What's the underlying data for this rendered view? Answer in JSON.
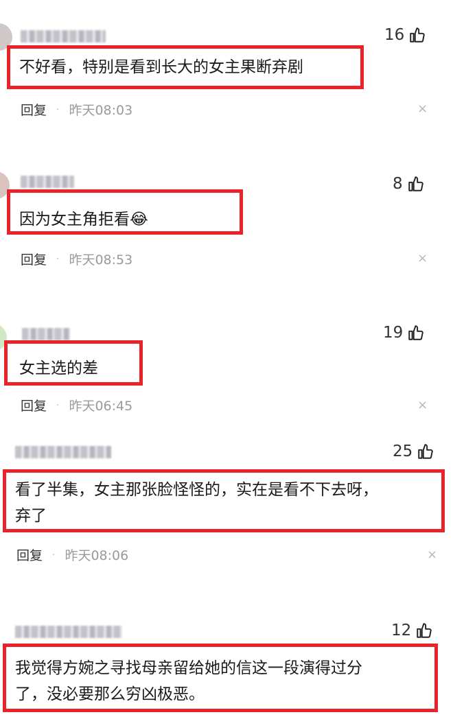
{
  "comments": [
    {
      "likes": "16",
      "text_lines": [
        "不好看，特别是看到长大的女主果断弃剧"
      ],
      "reply_label": "回复",
      "time": "昨天08:03"
    },
    {
      "likes": "8",
      "text_lines": [
        "因为女主角拒看😂"
      ],
      "reply_label": "回复",
      "time": "昨天08:53"
    },
    {
      "likes": "19",
      "text_lines": [
        "女主选的差"
      ],
      "reply_label": "回复",
      "time": "昨天06:45"
    },
    {
      "likes": "25",
      "text_lines": [
        "看了半集，女主那张脸怪怪的，实在是看不下去呀，",
        "弃了"
      ],
      "reply_label": "回复",
      "time": "昨天08:06"
    },
    {
      "likes": "12",
      "text_lines": [
        "我觉得方婉之寻找母亲留给她的信这一段演得过分",
        "了，没必要那么穷凶极恶。"
      ],
      "reply_label": "",
      "time": ""
    }
  ],
  "separator": "·",
  "close_glyph": "×",
  "colors": {
    "highlight_box": "#e8242a",
    "meta_gray": "#9a9a9a"
  },
  "icons": {
    "like": "thumbs-up-icon",
    "close": "close-icon"
  }
}
